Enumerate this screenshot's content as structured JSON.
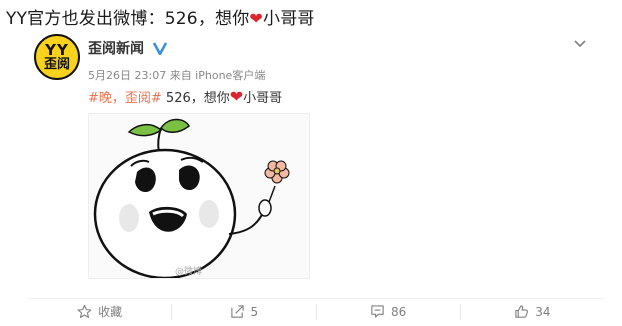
{
  "headline": {
    "prefix": "YY官方也发出微博：526，想你",
    "heart": "❤",
    "suffix": "小哥哥"
  },
  "post": {
    "avatar": {
      "top": "YY",
      "bottom": "歪阅"
    },
    "username": "歪阅新闻",
    "verified_icon": "verified-v-icon",
    "meta": "5月26日 23:07 来自 iPhone客户端",
    "tags": "#晚，歪阅#",
    "text_prefix": " 526，想你",
    "heart": "❤",
    "text_suffix": "小哥哥",
    "image": {
      "description_icon": "sprout-head-cartoon",
      "watermark": "@微博"
    }
  },
  "actions": [
    {
      "icon": "star-icon",
      "label": "收藏"
    },
    {
      "icon": "share-icon",
      "label": "5"
    },
    {
      "icon": "comment-icon",
      "label": "86"
    },
    {
      "icon": "like-icon",
      "label": "34"
    }
  ],
  "colors": {
    "accent": "#eb7350",
    "heart": "#e0242c",
    "avatar_bg": "#f8d21c",
    "verify": "#3d8ee3"
  }
}
